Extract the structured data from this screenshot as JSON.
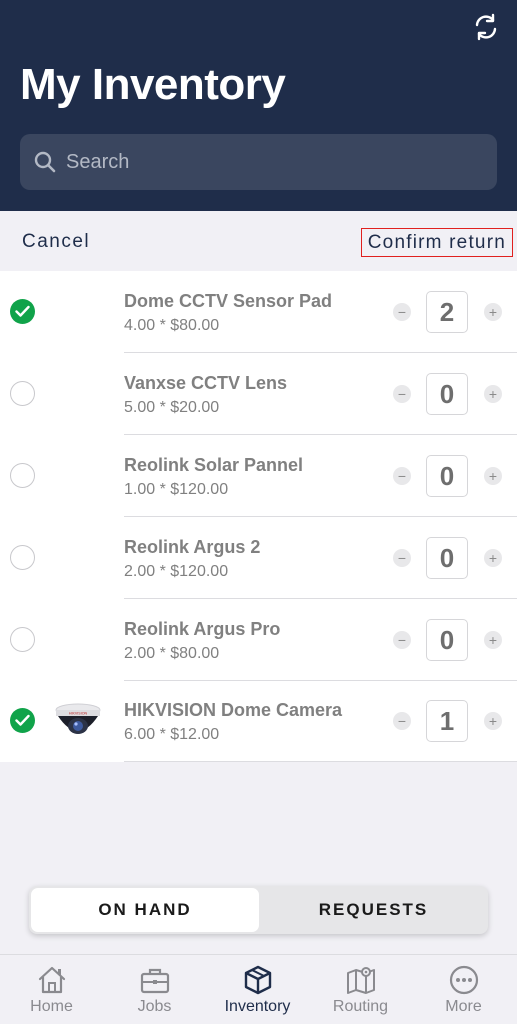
{
  "header": {
    "title": "My Inventory",
    "refresh_icon": "refresh-icon",
    "search": {
      "placeholder": "Search",
      "value": ""
    }
  },
  "actions": {
    "cancel_label": "Cancel",
    "confirm_label": "Confirm return"
  },
  "items": [
    {
      "name": "Dome CCTV Sensor Pad",
      "detail": "4.00 * $80.00",
      "qty": "2",
      "checked": true,
      "has_image": false
    },
    {
      "name": "Vanxse CCTV Lens",
      "detail": "5.00 * $20.00",
      "qty": "0",
      "checked": false,
      "has_image": false
    },
    {
      "name": "Reolink Solar Pannel",
      "detail": "1.00 * $120.00",
      "qty": "0",
      "checked": false,
      "has_image": false
    },
    {
      "name": "Reolink Argus 2",
      "detail": "2.00 * $120.00",
      "qty": "0",
      "checked": false,
      "has_image": false
    },
    {
      "name": "Reolink Argus Pro",
      "detail": "2.00 * $80.00",
      "qty": "0",
      "checked": false,
      "has_image": false
    },
    {
      "name": "HIKVISION Dome Camera",
      "detail": "6.00 * $12.00",
      "qty": "1",
      "checked": true,
      "has_image": true
    }
  ],
  "segment": {
    "on_hand_label": "ON HAND",
    "requests_label": "REQUESTS",
    "active": "on_hand"
  },
  "tabs": [
    {
      "label": "Home",
      "icon": "home-icon"
    },
    {
      "label": "Jobs",
      "icon": "briefcase-icon"
    },
    {
      "label": "Inventory",
      "icon": "box-icon",
      "active": true
    },
    {
      "label": "Routing",
      "icon": "map-icon"
    },
    {
      "label": "More",
      "icon": "more-icon"
    }
  ],
  "colors": {
    "header_bg": "#1f2d4a",
    "check_on": "#10a34a",
    "confirm_border": "#e0201e"
  }
}
